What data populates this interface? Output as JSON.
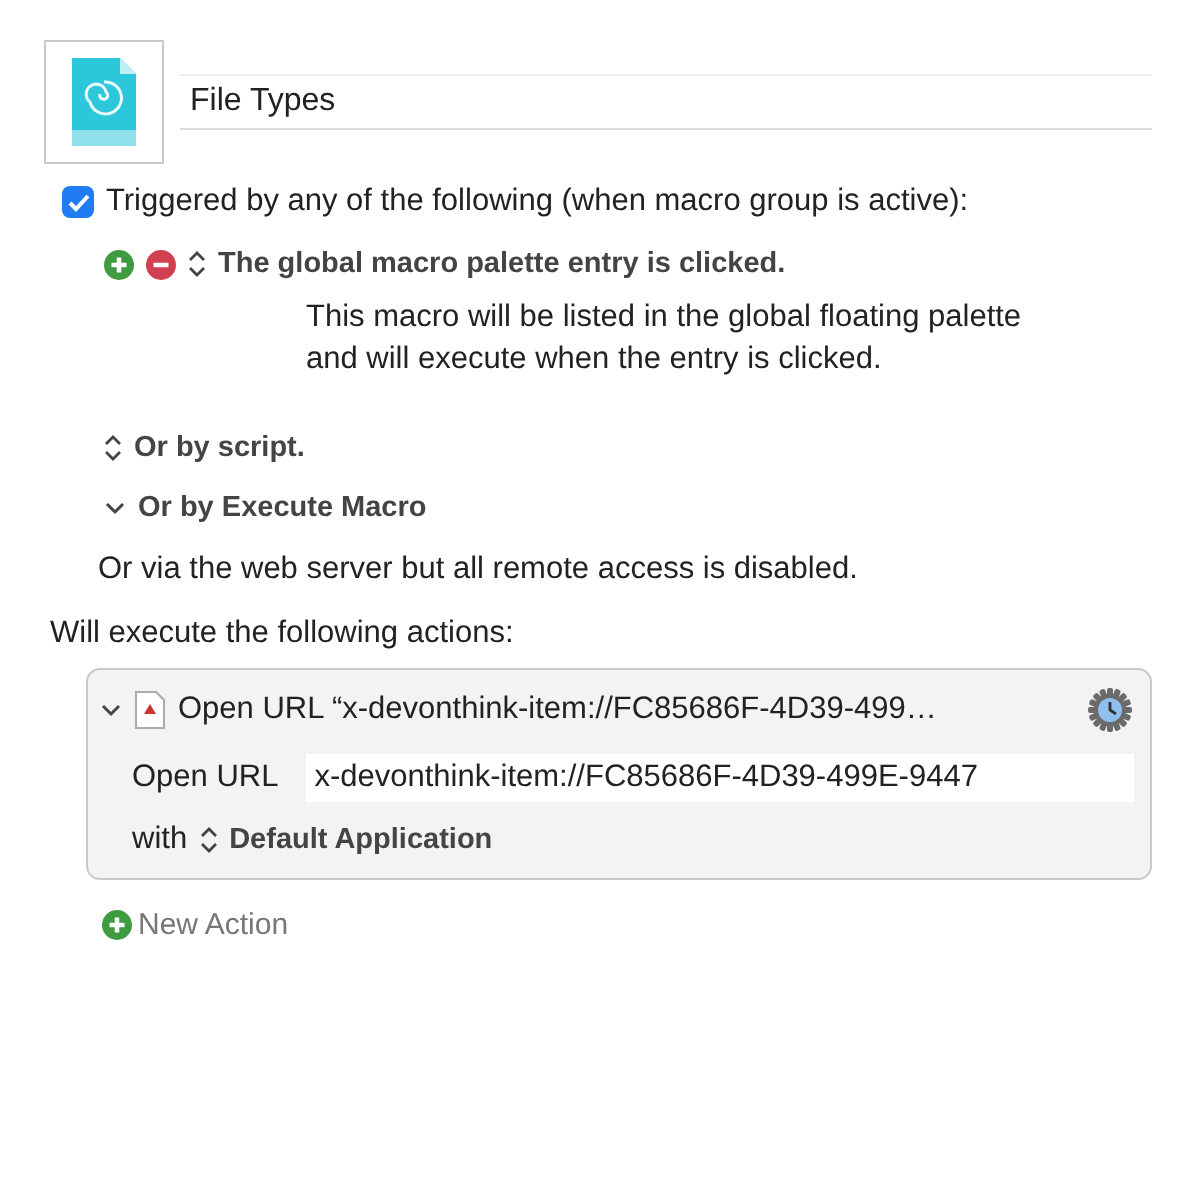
{
  "macro": {
    "name": "File Types"
  },
  "trigger_header": {
    "label": "Triggered by any of the following (when macro group is active):",
    "checked": true
  },
  "triggers": [
    {
      "kind": "popup",
      "label": "The global macro palette entry is clicked.",
      "removable": true,
      "description": "This macro will be listed in the global floating palette and will execute when the entry is clicked."
    },
    {
      "kind": "popup",
      "label": "Or by script.",
      "removable": false
    },
    {
      "kind": "disclosure",
      "label": "Or by Execute Macro",
      "expanded": true
    }
  ],
  "web_note": "Or via the web server but all remote access is disabled.",
  "actions_header": "Will execute the following actions:",
  "actions": [
    {
      "title": "Open URL “x-devonthink-item://FC85686F-4D39-499…",
      "expanded": true,
      "url_label": "Open URL",
      "url": "x-devonthink-item://FC85686F-4D39-499E-9447",
      "with_label": "with",
      "application": "Default Application"
    }
  ],
  "new_action": "New Action"
}
